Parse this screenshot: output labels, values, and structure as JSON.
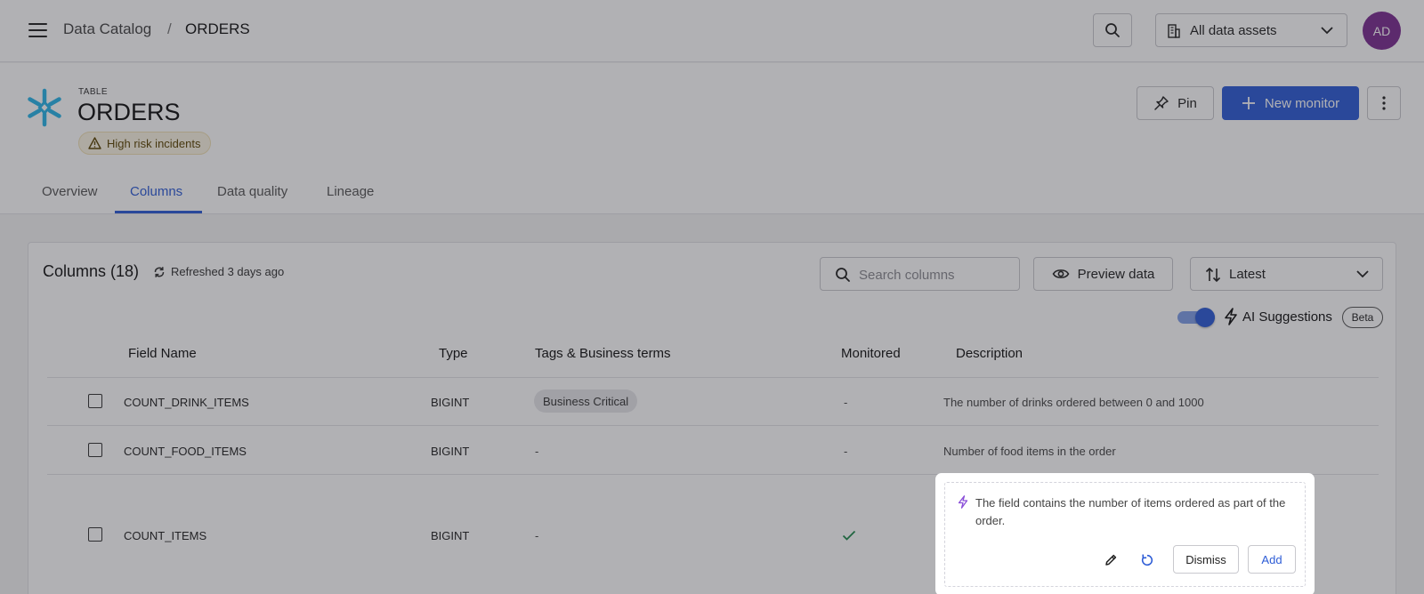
{
  "topbar": {
    "breadcrumb": [
      "Data Catalog",
      "/",
      "ORDERS"
    ],
    "asset_filter": "All data assets",
    "avatar_initials": "AD",
    "avatar_color": "#7a2c90"
  },
  "header": {
    "kind": "TABLE",
    "title": "ORDERS",
    "risk_badge": "High risk incidents",
    "pin_label": "Pin",
    "new_monitor_label": "New monitor",
    "accent_color": "#2d5cd6",
    "source_icon": "snowflake-icon"
  },
  "tabs": [
    {
      "label": "Overview",
      "active": false
    },
    {
      "label": "Columns",
      "active": true
    },
    {
      "label": "Data quality",
      "active": false
    },
    {
      "label": "Lineage",
      "active": false
    }
  ],
  "columns": {
    "title": "Columns (18)",
    "refreshed": "Refreshed 3 days ago",
    "search_placeholder": "Search columns",
    "preview_label": "Preview data",
    "sort_value": "Latest",
    "ai_toggle_on": true,
    "ai_label": "AI Suggestions",
    "beta_label": "Beta",
    "headers": [
      "Field Name",
      "Type",
      "Tags & Business terms",
      "Monitored",
      "Description"
    ],
    "rows": [
      {
        "field": "COUNT_DRINK_ITEMS",
        "type": "BIGINT",
        "tag": "Business Critical",
        "monitored": "-",
        "description": "The number of drinks ordered between 0 and 1000"
      },
      {
        "field": "COUNT_FOOD_ITEMS",
        "type": "BIGINT",
        "tag": "-",
        "monitored": "-",
        "description": "Number of food items in the order"
      },
      {
        "field": "COUNT_ITEMS",
        "type": "BIGINT",
        "tag": "-",
        "monitored": "check-icon",
        "description": ""
      }
    ]
  },
  "suggestion": {
    "text": "The field contains the number of items ordered as part of the order.",
    "dismiss_label": "Dismiss",
    "add_label": "Add"
  }
}
